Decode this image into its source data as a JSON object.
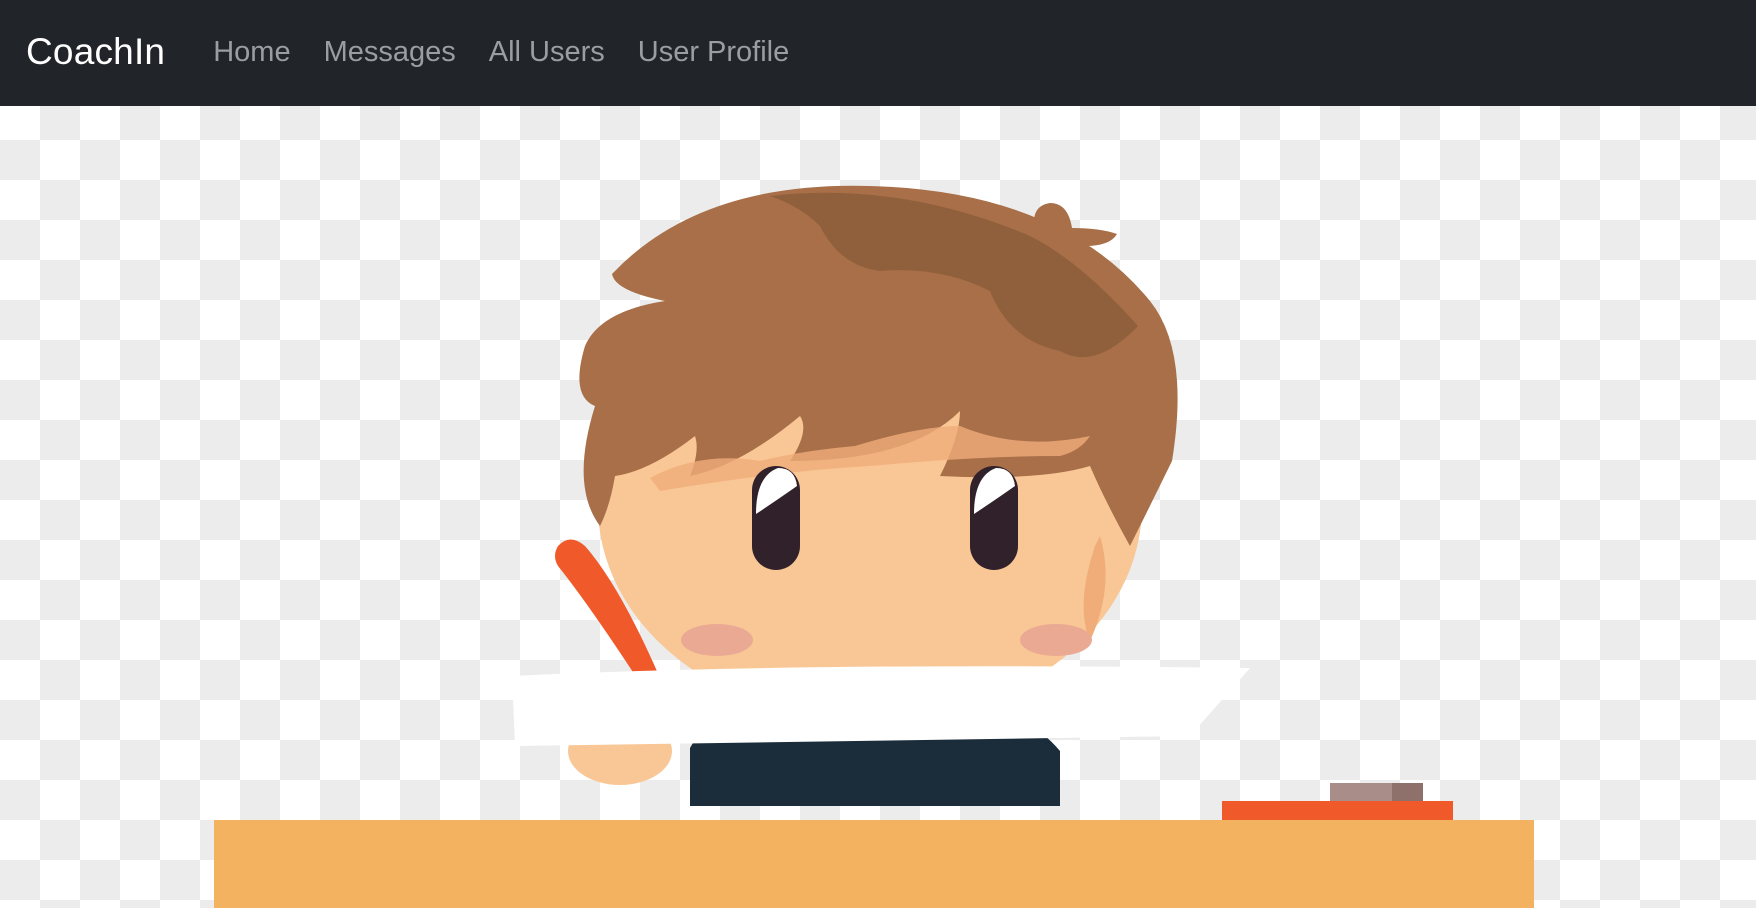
{
  "navbar": {
    "brand": "CoachIn",
    "links": [
      {
        "label": "Home"
      },
      {
        "label": "Messages"
      },
      {
        "label": "All Users"
      },
      {
        "label": "User Profile"
      }
    ]
  },
  "colors": {
    "navbar_bg": "#212529",
    "brand_text": "#ffffff",
    "nav_link_text": "#9a9da1",
    "checker_light": "#ffffff",
    "checker_dark": "#ececec",
    "hair": "#a86f48",
    "hair_shade": "#90603c",
    "skin": "#f9c795",
    "skin_shade": "#f0ad7a",
    "eye": "#30212a",
    "cheek": "#eaa993",
    "shirt": "#1b2d3b",
    "pencil": "#f05a2a",
    "desk": "#f2b25f",
    "paper": "#ffffff",
    "eraser": "#a98d88"
  },
  "hero": {
    "illustration": "child-writing-at-desk"
  }
}
